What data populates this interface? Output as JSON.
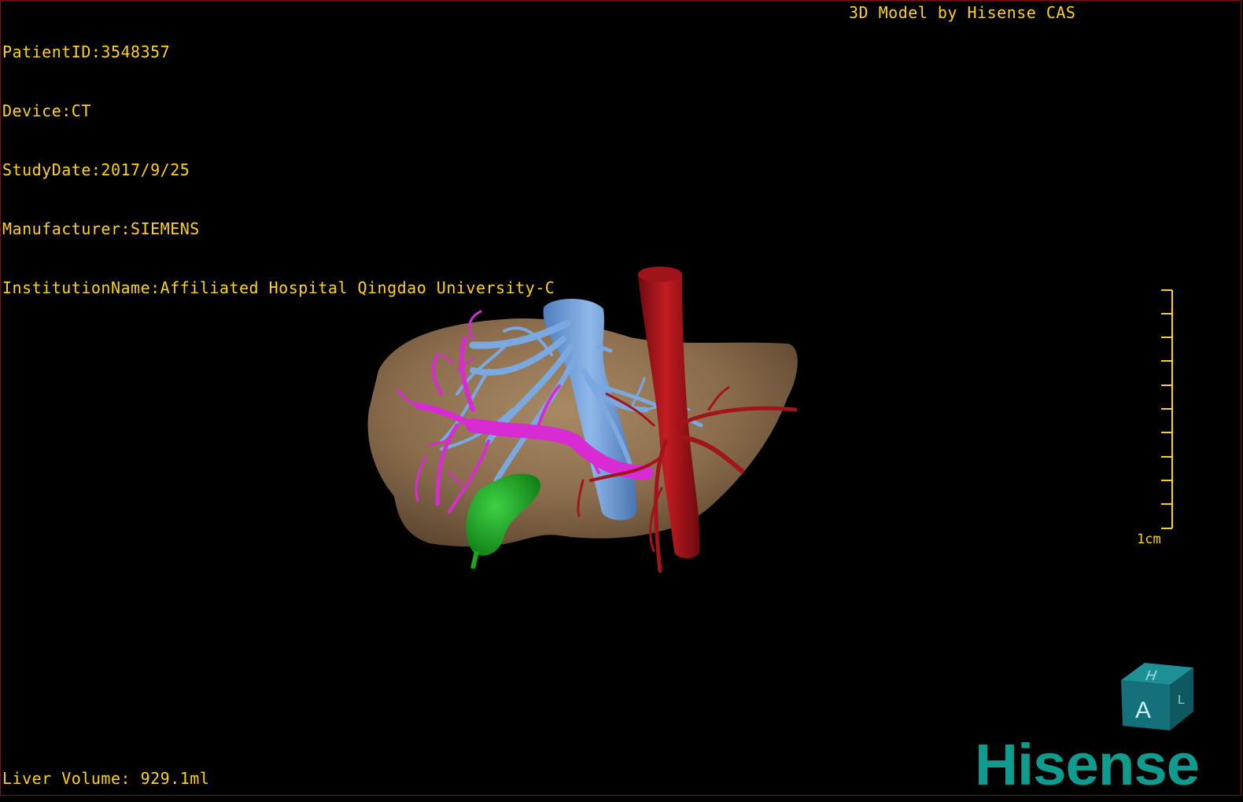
{
  "header": {
    "patient_id": "PatientID:3548357",
    "device": "Device:CT",
    "study_date": "StudyDate:2017/9/25",
    "manufacturer": "Manufacturer:SIEMENS",
    "institution": "InstitutionName:Affiliated Hospital Qingdao University-C",
    "brand_line": "3D Model by Hisense CAS"
  },
  "footer": {
    "liver_volume": "Liver Volume: 929.1ml"
  },
  "scale": {
    "label": "1cm"
  },
  "orientation": {
    "top_face_letter": "H",
    "front_face_letter": "A",
    "side_face_letter": "L"
  },
  "logo": {
    "text": "Hisense"
  },
  "colors": {
    "overlay_text": "#ffd21a",
    "liver": "#8c6f4d",
    "hepatic_vein": "#6f9fd8",
    "portal_vein": "#d92bd4",
    "artery": "#a3141a",
    "gallbladder": "#1aa71f",
    "logo": "#0f9b8e",
    "border": "#7a1418"
  },
  "icons": [
    "orientation-cube-icon",
    "scale-bar-icon"
  ]
}
